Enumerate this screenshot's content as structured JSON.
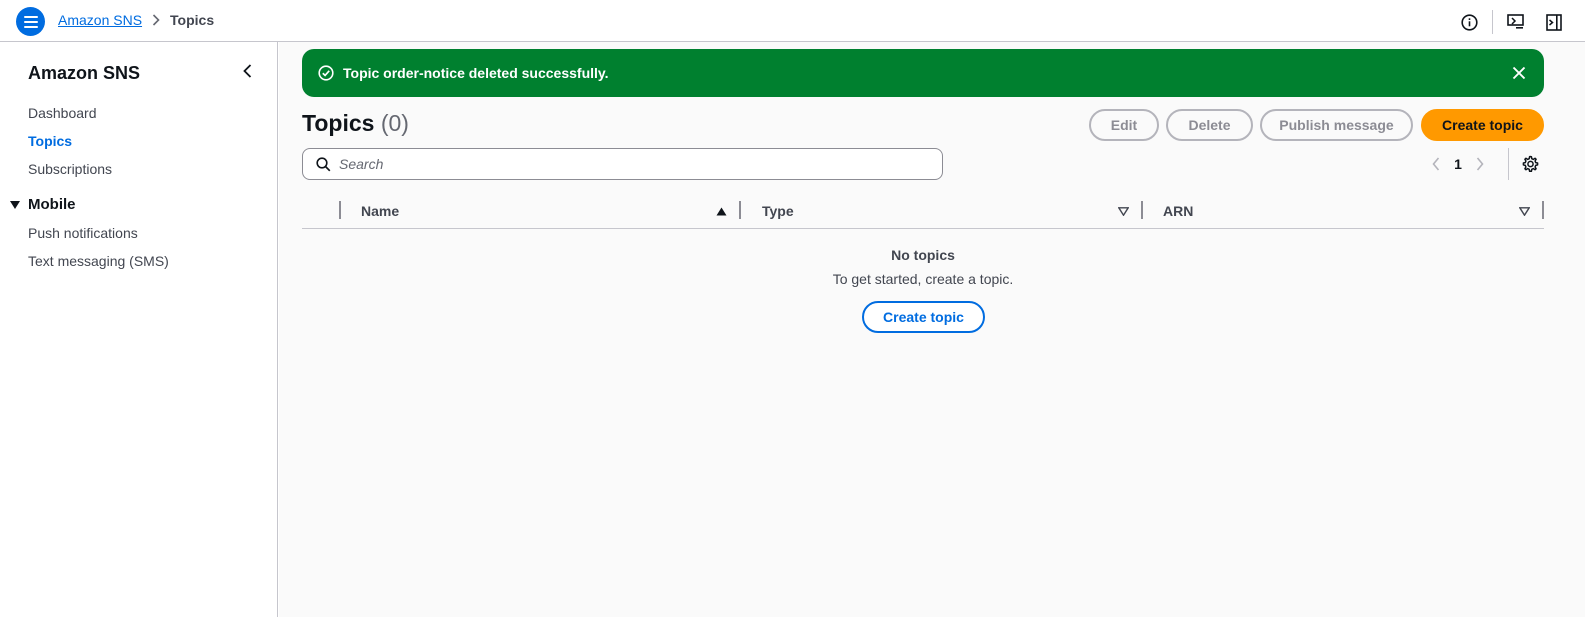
{
  "header": {
    "breadcrumb": {
      "service": "Amazon SNS",
      "current": "Topics"
    },
    "icons": [
      "info-icon",
      "feedback-icon",
      "panel-icon"
    ]
  },
  "sidebar": {
    "title": "Amazon SNS",
    "items": [
      {
        "label": "Dashboard",
        "active": false
      },
      {
        "label": "Topics",
        "active": true
      },
      {
        "label": "Subscriptions",
        "active": false
      }
    ],
    "section": {
      "title": "Mobile",
      "items": [
        {
          "label": "Push notifications"
        },
        {
          "label": "Text messaging (SMS)"
        }
      ]
    }
  },
  "flash": {
    "message": "Topic order-notice deleted successfully.",
    "color": "#00802f"
  },
  "main": {
    "title": "Topics",
    "count": "(0)",
    "buttons": {
      "edit": "Edit",
      "delete": "Delete",
      "publish": "Publish message",
      "create": "Create topic"
    },
    "search": {
      "placeholder": "Search",
      "value": ""
    },
    "pagination": {
      "current_page": "1"
    },
    "table": {
      "columns": [
        "Name",
        "Type",
        "ARN"
      ]
    },
    "empty": {
      "title": "No topics",
      "subtitle": "To get started, create a topic.",
      "action": "Create topic"
    }
  },
  "colors": {
    "accent": "#006ce0",
    "primary_button": "#ff9900",
    "success": "#00802f"
  }
}
